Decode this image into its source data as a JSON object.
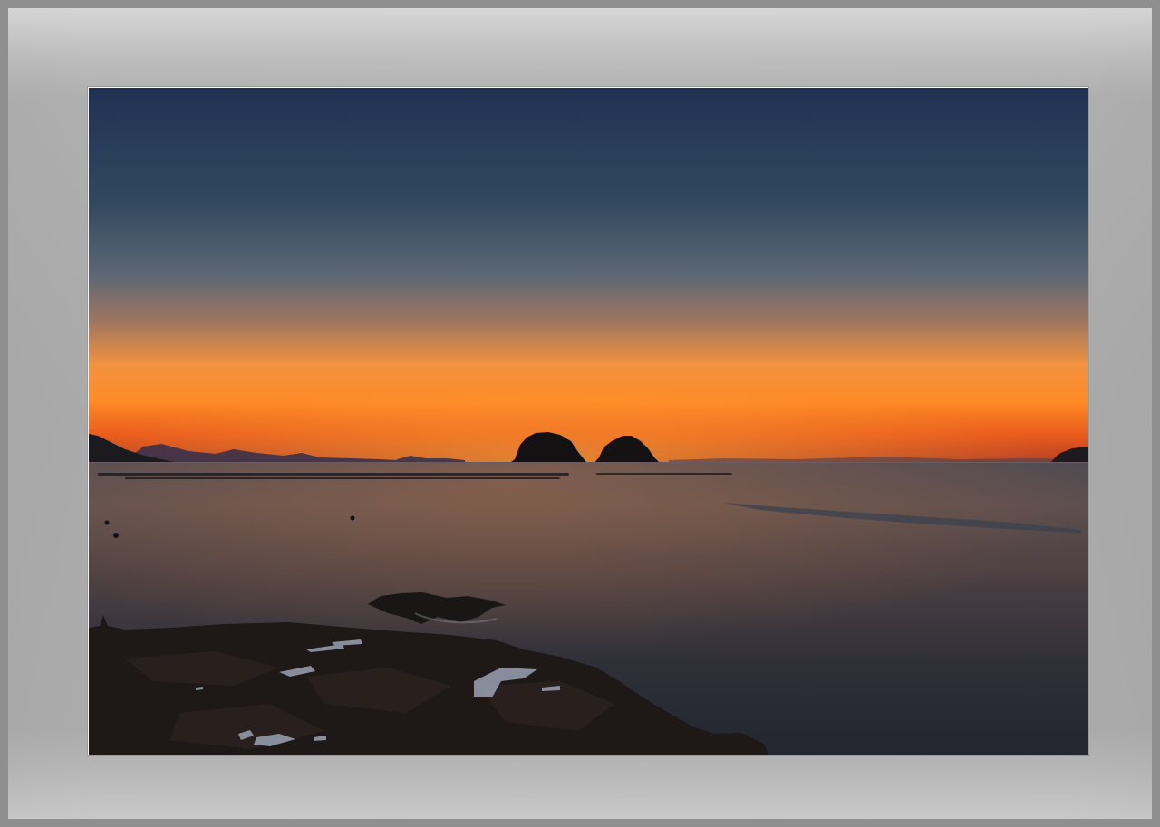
{
  "scene": {
    "subject": "sunset-seascape",
    "colors": {
      "sky_top": "#1d3150",
      "sky_mid": "#3f5872",
      "horizon_orange": "#ff7a1e",
      "horizon_red": "#d8451c",
      "water": "#2e2f36",
      "rocks": "#1a1514",
      "mat": "#b4b4b4",
      "outer_frame": "#8f8f8f"
    }
  }
}
